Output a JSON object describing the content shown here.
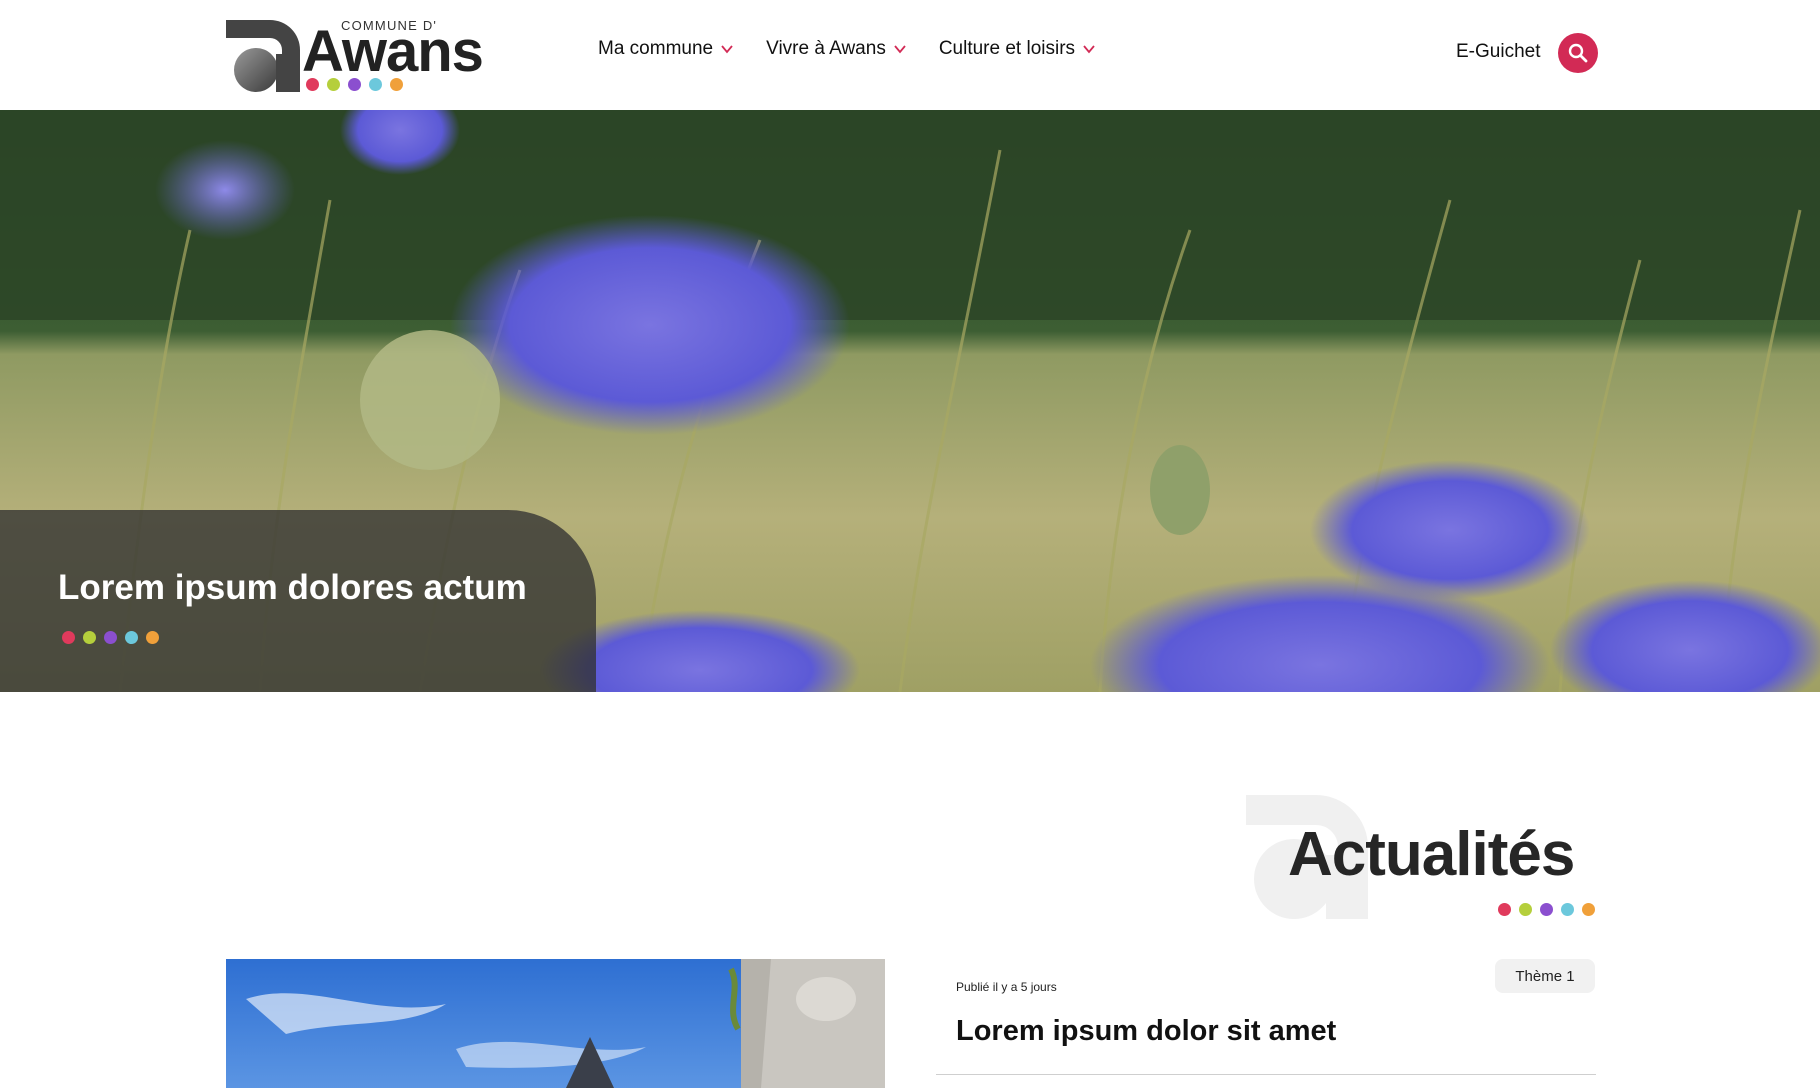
{
  "colors": {
    "brand_red": "#d22a55",
    "dot_colors": [
      "#e03a5c",
      "#b5cf3c",
      "#8b4fcf",
      "#6cc8dc",
      "#f0a03a"
    ]
  },
  "header": {
    "logo_small": "COMMUNE D'",
    "logo_big": "Awans",
    "nav": [
      {
        "label": "Ma commune",
        "icon": "chevron-down-icon"
      },
      {
        "label": "Vivre à Awans",
        "icon": "chevron-down-icon"
      },
      {
        "label": "Culture et loisirs",
        "icon": "chevron-down-icon"
      }
    ],
    "eguichet": "E-Guichet",
    "search_icon": "search-icon"
  },
  "hero": {
    "title": "Lorem ipsum dolores actum"
  },
  "actualites": {
    "heading": "Actualités",
    "article": {
      "date": "Publié il y a 5 jours",
      "title": "Lorem ipsum dolor sit amet",
      "theme": "Thème 1"
    }
  }
}
